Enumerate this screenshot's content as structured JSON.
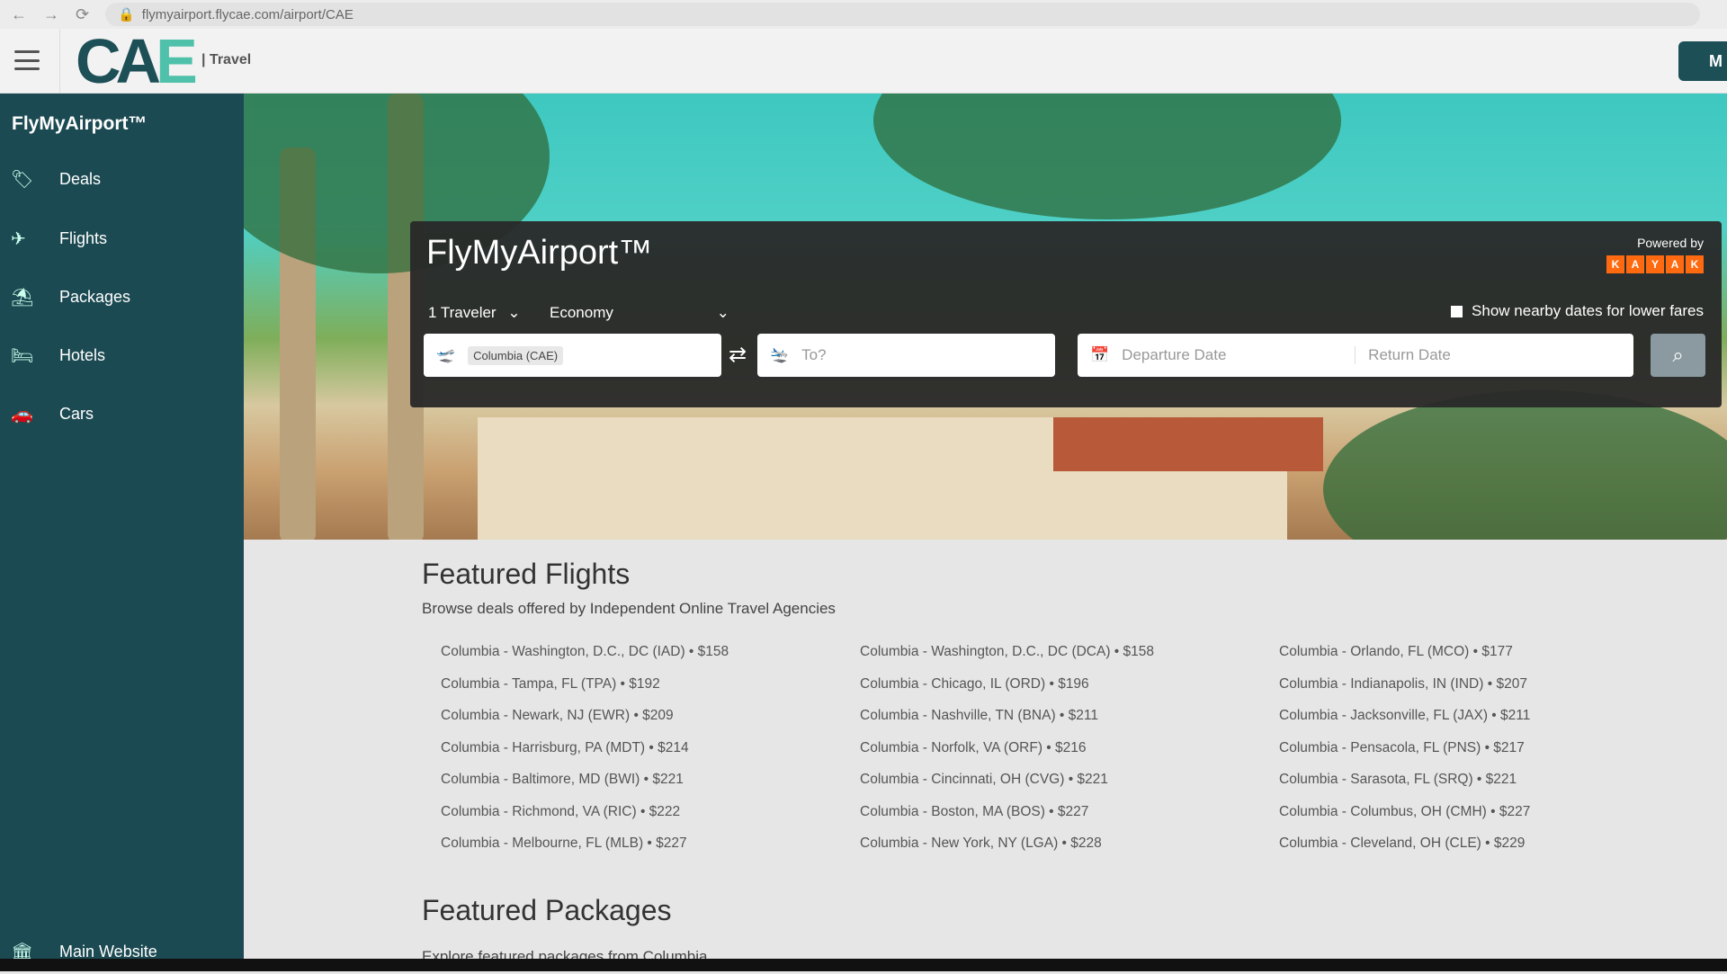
{
  "browser": {
    "url": "flymyairport.flycae.com/airport/CAE"
  },
  "header": {
    "logo": "CAE",
    "section": "| Travel",
    "button": "M"
  },
  "sidebar": {
    "brand": "FlyMyAirport™",
    "items": [
      {
        "label": "Deals",
        "icon": "tag-icon"
      },
      {
        "label": "Flights",
        "icon": "plane-icon"
      },
      {
        "label": "Packages",
        "icon": "beach-umbrella-icon"
      },
      {
        "label": "Hotels",
        "icon": "bed-icon"
      },
      {
        "label": "Cars",
        "icon": "car-icon"
      }
    ],
    "footer": "Main Website"
  },
  "search": {
    "title": "FlyMyAirport™",
    "powered_by": "Powered by",
    "kayak": [
      "K",
      "A",
      "Y",
      "A",
      "K"
    ],
    "travelers": "1 Traveler",
    "cabin": "Economy",
    "nearby_label": "Show nearby dates for lower fares",
    "nearby_checked": false,
    "from": "Columbia (CAE)",
    "to_placeholder": "To?",
    "departure_placeholder": "Departure Date",
    "return_placeholder": "Return Date"
  },
  "featured_flights": {
    "title": "Featured Flights",
    "subtitle": "Browse deals offered by Independent Online Travel Agencies",
    "columns": [
      [
        "Columbia - Washington, D.C., DC (IAD) • $158",
        "Columbia - Tampa, FL (TPA) • $192",
        "Columbia - Newark, NJ (EWR) • $209",
        "Columbia - Harrisburg, PA (MDT) • $214",
        "Columbia - Baltimore, MD (BWI) • $221",
        "Columbia - Richmond, VA (RIC) • $222",
        "Columbia - Melbourne, FL (MLB) • $227"
      ],
      [
        "Columbia - Washington, D.C., DC (DCA) • $158",
        "Columbia - Chicago, IL (ORD) • $196",
        "Columbia - Nashville, TN (BNA) • $211",
        "Columbia - Norfolk, VA (ORF) • $216",
        "Columbia - Cincinnati, OH (CVG) • $221",
        "Columbia - Boston, MA (BOS) • $227",
        "Columbia - New York, NY (LGA) • $228"
      ],
      [
        "Columbia - Orlando, FL (MCO) • $177",
        "Columbia - Indianapolis, IN (IND) • $207",
        "Columbia - Jacksonville, FL (JAX) • $211",
        "Columbia - Pensacola, FL (PNS) • $217",
        "Columbia - Sarasota, FL (SRQ) • $221",
        "Columbia - Columbus, OH (CMH) • $227",
        "Columbia - Cleveland, OH (CLE) • $229"
      ]
    ]
  },
  "featured_packages": {
    "title": "Featured Packages",
    "subtitle": "Explore featured packages from Columbia."
  }
}
